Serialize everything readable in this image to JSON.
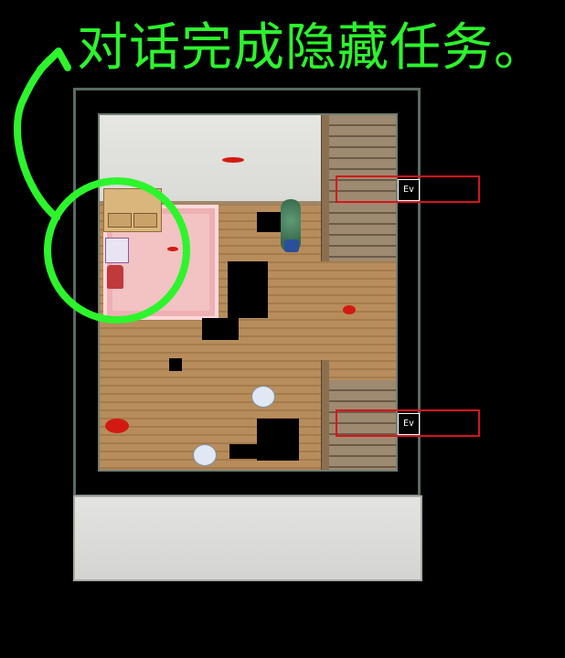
{
  "caption": "对话完成隐藏任务。",
  "colors": {
    "caption": "#2cf52c",
    "highlight_circle": "#2cf52c",
    "event_box": "#d8141d"
  },
  "events": [
    {
      "label": "Ev"
    },
    {
      "label": "Ev"
    }
  ],
  "icons": [
    "npc-girl-icon",
    "red-chair-icon",
    "potted-plant-icon",
    "bunny-ghost-icon",
    "blood-splatter-icon"
  ]
}
